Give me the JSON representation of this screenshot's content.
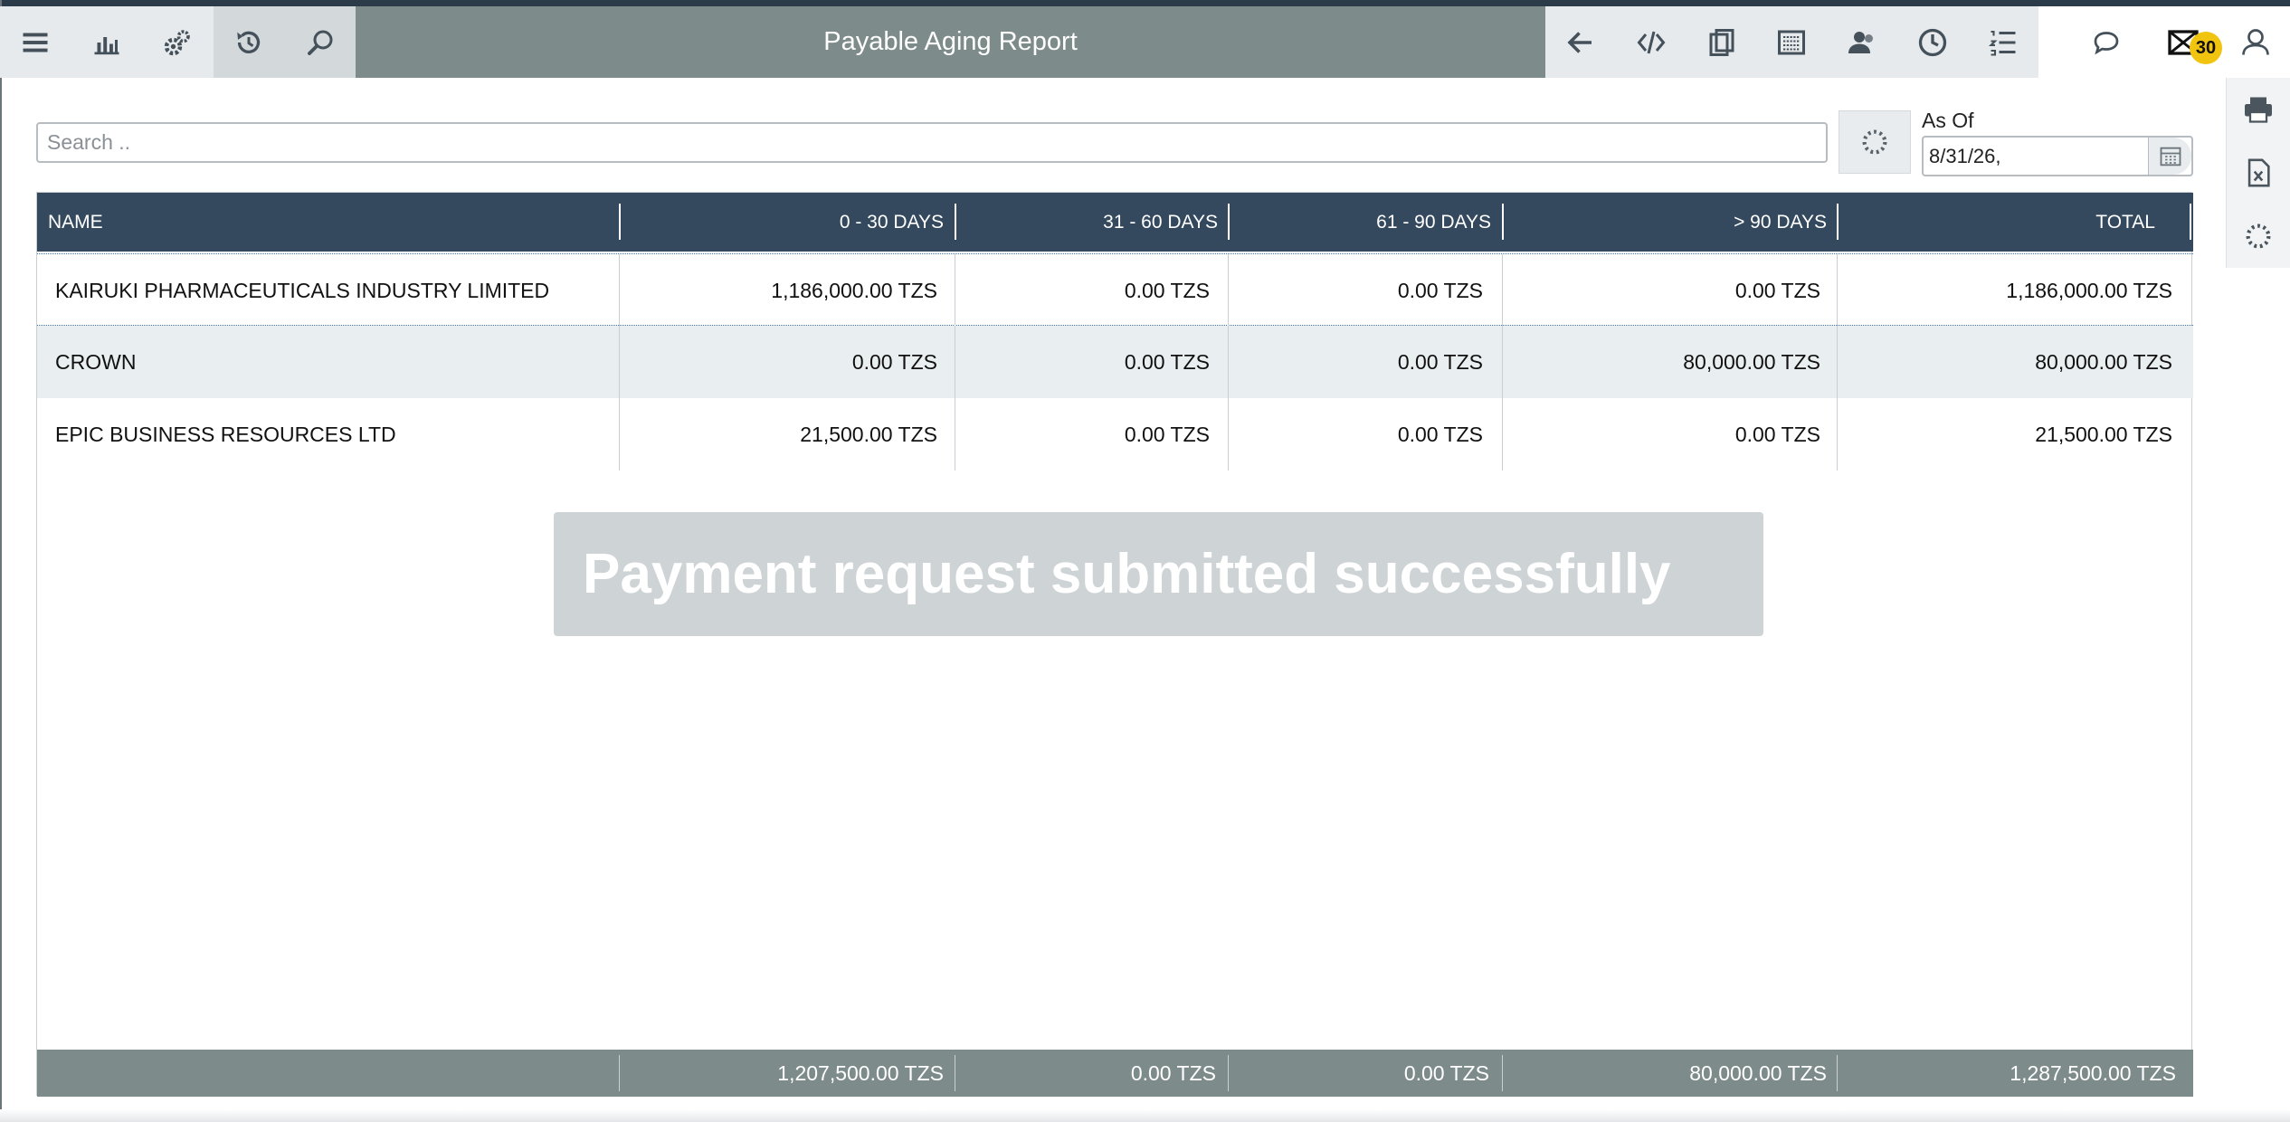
{
  "window": {
    "title": "Payable Aging Report"
  },
  "toolbar": {
    "left_icons": [
      "menu-icon",
      "bar-chart-icon",
      "gears-icon",
      "history-icon",
      "search-icon"
    ],
    "right_icons": [
      "back-arrow-icon",
      "code-icon",
      "clipboard-icon",
      "keyboard-icon",
      "users-icon",
      "clock-icon",
      "list-icon"
    ],
    "chat_icon": "chat-bubble-icon",
    "mail_icon": "mail-icon",
    "mail_badge": "30",
    "user_icon": "user-icon"
  },
  "filters": {
    "search_placeholder": "Search ..",
    "as_of_label": "As Of",
    "as_of_value": "8/31/26,"
  },
  "sidebar": {
    "icons": [
      "print-icon",
      "excel-icon",
      "refresh-icon"
    ]
  },
  "table": {
    "columns": [
      "NAME",
      "0 - 30 DAYS",
      "31 - 60 DAYS",
      "61 - 90 DAYS",
      "> 90 DAYS",
      "TOTAL"
    ],
    "rows": [
      [
        "KAIRUKI PHARMACEUTICALS INDUSTRY LIMITED",
        "1,186,000.00 TZS",
        "0.00 TZS",
        "0.00 TZS",
        "0.00 TZS",
        "1,186,000.00 TZS"
      ],
      [
        "CROWN",
        "0.00 TZS",
        "0.00 TZS",
        "0.00 TZS",
        "80,000.00 TZS",
        "80,000.00 TZS"
      ],
      [
        "EPIC BUSINESS RESOURCES LTD",
        "21,500.00 TZS",
        "0.00 TZS",
        "0.00 TZS",
        "0.00 TZS",
        "21,500.00 TZS"
      ]
    ],
    "totals": [
      "",
      "1,207,500.00 TZS",
      "0.00 TZS",
      "0.00 TZS",
      "80,000.00 TZS",
      "1,287,500.00 TZS"
    ]
  },
  "toast": {
    "message": "Payment request submitted successfully"
  },
  "colors": {
    "header": "#34495e",
    "title_bar": "#7e8b8b",
    "footer": "#7e8b8b",
    "badge": "#f1c40f"
  }
}
